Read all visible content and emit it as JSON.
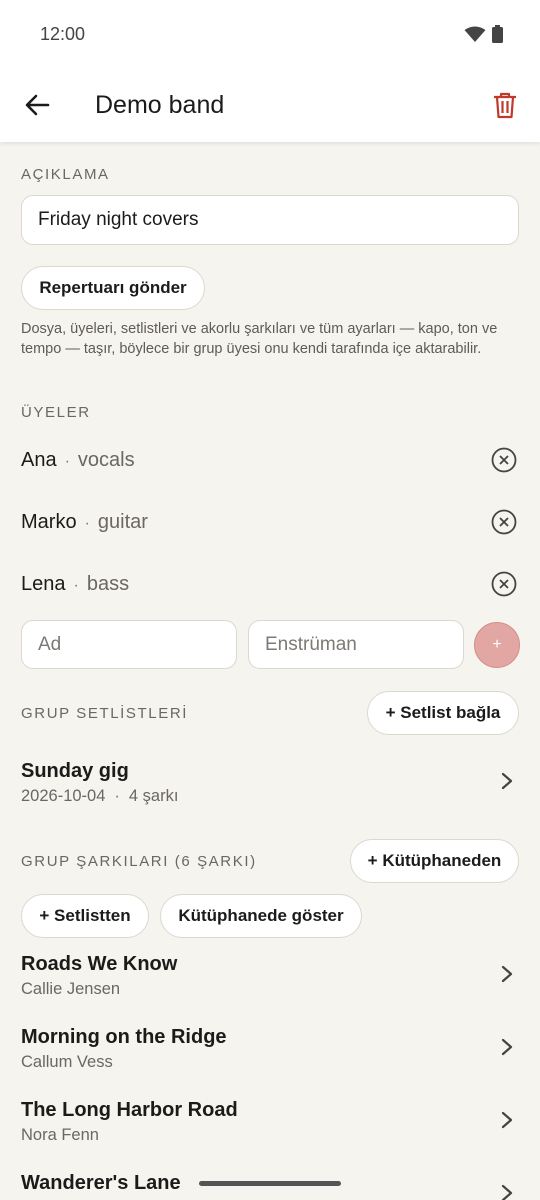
{
  "status_bar": {
    "time": "12:00"
  },
  "app_bar": {
    "title": "Demo band"
  },
  "description": {
    "label": "AÇIKLAMA",
    "value": "Friday night covers"
  },
  "send_repertoire_label": "Repertuarı gönder",
  "help_text": "Dosya, üyeleri, setlistleri ve akorlu şarkıları ve tüm ayarları — kapo, ton ve tempo — taşır, böylece bir grup üyesi onu kendi tarafında içe aktarabilir.",
  "members": {
    "label": "ÜYELER",
    "items": [
      {
        "name": "Ana",
        "role": "vocals"
      },
      {
        "name": "Marko",
        "role": "guitar"
      },
      {
        "name": "Lena",
        "role": "bass"
      }
    ],
    "separator": "·",
    "name_placeholder": "Ad",
    "instrument_placeholder": "Enstrüman",
    "add_symbol": "+"
  },
  "setlists": {
    "label": "GRUP SETLİSTLERİ",
    "attach_label": "+ Setlist bağla",
    "items": [
      {
        "title": "Sunday gig",
        "date": "2026-10-04",
        "count": "4 şarkı"
      }
    ]
  },
  "songs": {
    "label": "GRUP ŞARKILARI (6 ŞARKI)",
    "from_library_label": "+ Kütüphaneden",
    "from_setlist_label": "+ Setlistten",
    "show_in_library_label": "Kütüphanede göster",
    "items": [
      {
        "title": "Roads We Know",
        "artist": "Callie Jensen"
      },
      {
        "title": "Morning on the Ridge",
        "artist": "Callum Vess"
      },
      {
        "title": "The Long Harbor Road",
        "artist": "Nora Fenn"
      },
      {
        "title": "Wanderer's Lane",
        "artist": ""
      }
    ]
  },
  "colors": {
    "accent": "#c0392b",
    "background": "#f6f4ef",
    "add_button": "#e2a7a2"
  },
  "icons": {
    "back": "arrow-left-icon",
    "delete": "trash-icon",
    "remove": "close-circle-icon",
    "chevron": "chevron-right-icon",
    "wifi": "wifi-icon",
    "battery": "battery-icon"
  }
}
